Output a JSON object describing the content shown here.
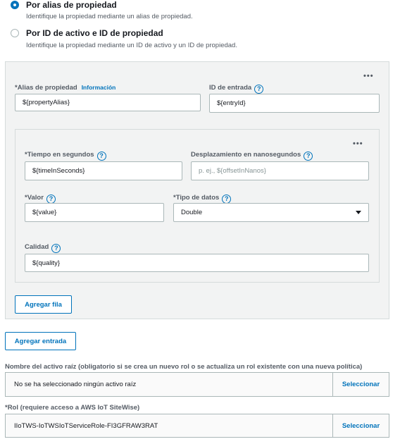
{
  "identification": {
    "alias_option": {
      "title": "Por alias de propiedad",
      "description": "Identifique la propiedad mediante un alias de propiedad."
    },
    "asset_option": {
      "title": "Por ID de activo e ID de propiedad",
      "description": "Identifique la propiedad mediante un ID de activo y un ID de propiedad."
    },
    "selected": "alias"
  },
  "entry": {
    "menu": "•••",
    "property_alias": {
      "label": "*Alias de propiedad",
      "info": "Información",
      "value": "${propertyAlias}"
    },
    "entry_id": {
      "label": "ID de entrada",
      "value": "${entryId}"
    },
    "value_row": {
      "menu": "•••",
      "time_in_seconds": {
        "label": "*Tiempo en segundos",
        "value": "${timeInSeconds}"
      },
      "offset_nanos": {
        "label": "Desplazamiento en nanosegundos",
        "placeholder": "p. ej., ${offsetInNanos}"
      },
      "value": {
        "label": "*Valor",
        "value": "${value}"
      },
      "data_type": {
        "label": "*Tipo de datos",
        "selected": "Double"
      },
      "quality": {
        "label": "Calidad",
        "value": "${quality}"
      }
    },
    "add_row_label": "Agregar fila"
  },
  "add_entry_label": "Agregar entrada",
  "root_asset": {
    "label": "Nombre del activo raíz (obligatorio si se crea un nuevo rol o se actualiza un rol existente con una nueva política)",
    "value": "No se ha seleccionado ningún activo raíz",
    "action": "Seleccionar"
  },
  "role": {
    "label": "*Rol (requiere acceso a AWS IoT SiteWise)",
    "value": "IIoTWS-IoTWSIoTServiceRole-FI3GFRAW3RAT",
    "action": "Seleccionar"
  },
  "help_glyph": "?",
  "colors": {
    "accent": "#0073bb",
    "panel": "#f2f3f3",
    "border": "#aab7b8"
  }
}
